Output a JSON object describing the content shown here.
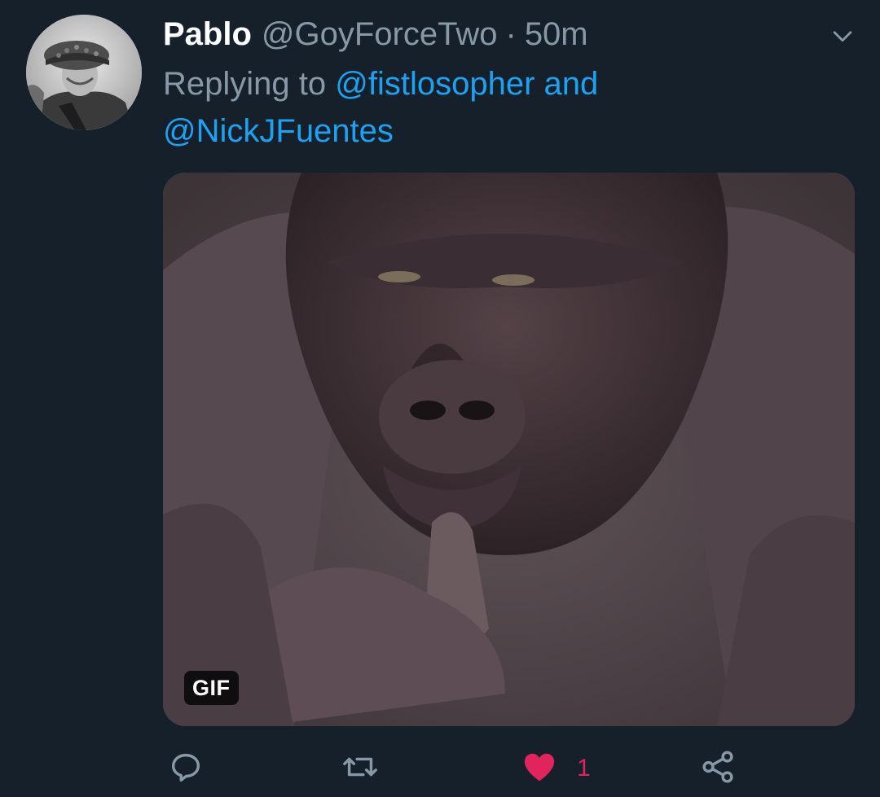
{
  "tweet": {
    "display_name": "Pablo",
    "handle": "@GoyForceTwo",
    "separator": "·",
    "time": "50m",
    "replying_prefix": "Replying to",
    "mention_1": "@fistlosopher",
    "conjunction": "and",
    "mention_2": "@NickJFuentes",
    "media_badge": "GIF"
  },
  "actions": {
    "reply_icon": "reply-icon",
    "retweet_icon": "retweet-icon",
    "like_icon": "heart-icon",
    "like_count": "1",
    "share_icon": "share-icon"
  },
  "colors": {
    "background": "#15202b",
    "secondary_text": "#8899a6",
    "link": "#1da1f2",
    "like": "#e0245e"
  }
}
